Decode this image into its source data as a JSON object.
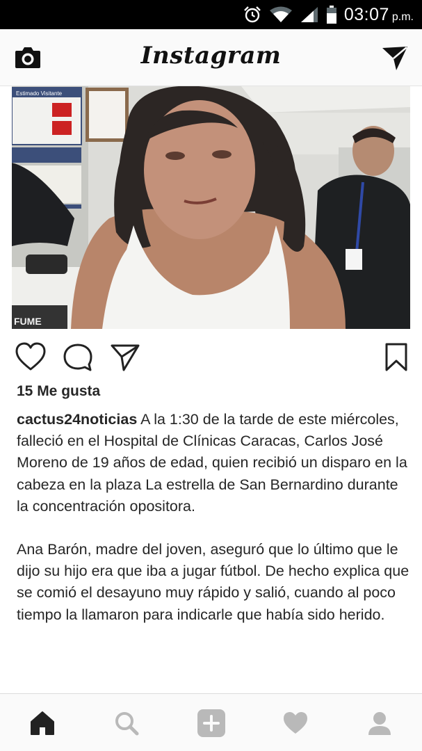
{
  "status_bar": {
    "time": "03:07",
    "ampm": "p.m.",
    "icons": [
      "alarm-icon",
      "wifi-icon",
      "signal-icon",
      "battery-icon"
    ]
  },
  "header": {
    "logo_text": "Instagram",
    "left_icon": "camera-icon",
    "right_icon": "direct-message-icon"
  },
  "post": {
    "photo_sign_texts": [
      "Estimado Visitante",
      "FUME"
    ],
    "actions": [
      "heart-icon",
      "comment-icon",
      "share-icon",
      "bookmark-icon"
    ],
    "likes_text": "15 Me gusta",
    "username": "cactus24noticias",
    "caption_p1": "A la 1:30 de la tarde de este miércoles, falleció en el Hospital de Clínicas Caracas, Carlos José Moreno de 19 años de edad, quien recibió un disparo en la cabeza en la plaza La estrella de San Bernardino durante la concentración opositora.",
    "caption_p2": "Ana Barón, madre del joven, aseguró que lo último que le dijo su hijo era que iba a jugar fútbol. De hecho explica que se comió el desayuno muy rápido y salió,  cuando al poco tiempo la llamaron para indicarle que había sido herido."
  },
  "bottom_nav": {
    "items": [
      "home-icon",
      "search-icon",
      "add-post-icon",
      "activity-heart-icon",
      "profile-icon"
    ],
    "active": "home-icon"
  }
}
